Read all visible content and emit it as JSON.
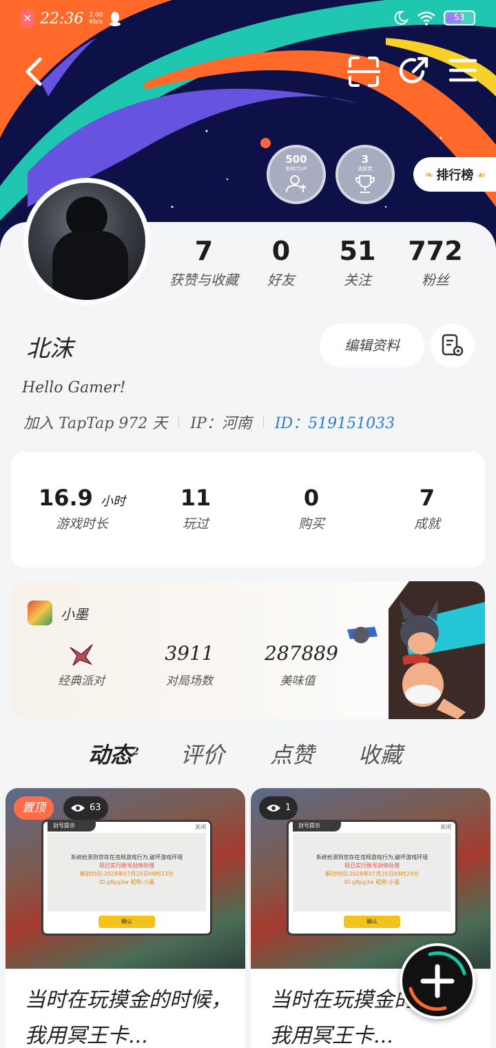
{
  "statusbar": {
    "time": "22:36",
    "speed_value": "2.00",
    "speed_unit": "Kb/s",
    "battery": "53"
  },
  "medals": [
    {
      "value": "500",
      "label": "影响力UP"
    },
    {
      "value": "3",
      "label": "成就党"
    }
  ],
  "rank_label": "排行榜",
  "stats": [
    {
      "value": "7",
      "label": "获赞与收藏"
    },
    {
      "value": "0",
      "label": "好友"
    },
    {
      "value": "51",
      "label": "关注"
    },
    {
      "value": "772",
      "label": "粉丝"
    }
  ],
  "profile": {
    "username": "北沫",
    "edit_label": "编辑资料",
    "bio": "Hello Gamer!",
    "joined": "加入 TapTap 972 天",
    "ip": "IP：河南",
    "uid": "ID：519151033"
  },
  "game_stats": [
    {
      "value": "16.9",
      "unit": "小时",
      "label": "游戏时长"
    },
    {
      "value": "11",
      "unit": "",
      "label": "玩过"
    },
    {
      "value": "0",
      "unit": "",
      "label": "购买"
    },
    {
      "value": "7",
      "unit": "",
      "label": "成就"
    }
  ],
  "eggy": {
    "game_name": "小墨",
    "stats": [
      {
        "value": "",
        "label": "经典派对"
      },
      {
        "value": "3911",
        "label": "对局场数"
      },
      {
        "value": "287889",
        "label": "美味值"
      }
    ]
  },
  "tabs": [
    {
      "label": "动态",
      "badge": "2"
    },
    {
      "label": "评价",
      "badge": ""
    },
    {
      "label": "点赞",
      "badge": ""
    },
    {
      "label": "收藏",
      "badge": ""
    }
  ],
  "posts": [
    {
      "pin": "置顶",
      "views": "63",
      "title": "当时在玩摸金的时候，我用冥王卡...",
      "dialog": {
        "header": "封号提示",
        "close": "关闭",
        "line1": "系统检测到您存在违规游戏行为,破坏游戏环境",
        "line2": "现已实行账号封停处理",
        "line3": "解封时间:2028年07月25日09时23分",
        "line4": "ID:g8pg3w 昵称:小墨",
        "confirm": "确认"
      }
    },
    {
      "pin": "",
      "views": "1",
      "title": "当时在玩摸金的时候，我用冥王卡...",
      "dialog": {
        "header": "封号提示",
        "close": "关闭",
        "line1": "系统检测到您存在违规游戏行为,破坏游戏环境",
        "line2": "现已实行账号封停处理",
        "line3": "解封时间:2028年07月25日09时23分",
        "line4": "ID:g8pg3w 昵称:小墨",
        "confirm": "确认"
      }
    }
  ],
  "colors": {
    "accent": "#18c3a8",
    "uid": "#2b7bd0",
    "pin": "#ff6c4a"
  }
}
